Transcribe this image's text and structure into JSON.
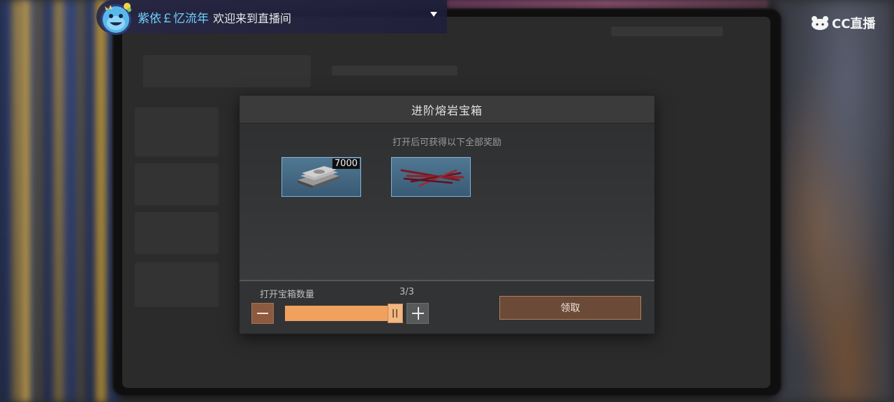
{
  "stream_overlay": {
    "username": "紫依￡忆流年",
    "message": "欢迎来到直播间",
    "logo_text": "CC直播"
  },
  "dialog": {
    "title": "进阶熔岩宝箱",
    "subtitle": "打开后可获得以下全部奖励",
    "rewards": [
      {
        "icon": "cash-bundle-icon",
        "count": "7000"
      },
      {
        "icon": "red-sticks-icon"
      }
    ],
    "quantity": {
      "label": "打开宝箱数量",
      "display": "3/3",
      "current": 3,
      "max": 3,
      "fill_fraction": 1.0
    },
    "claim_label": "领取"
  },
  "colors": {
    "accent_orange": "#f0a15e",
    "button_brown": "#6b4a38",
    "reward_frame": "#7fb2dc",
    "username_blue": "#6fd0ff"
  }
}
